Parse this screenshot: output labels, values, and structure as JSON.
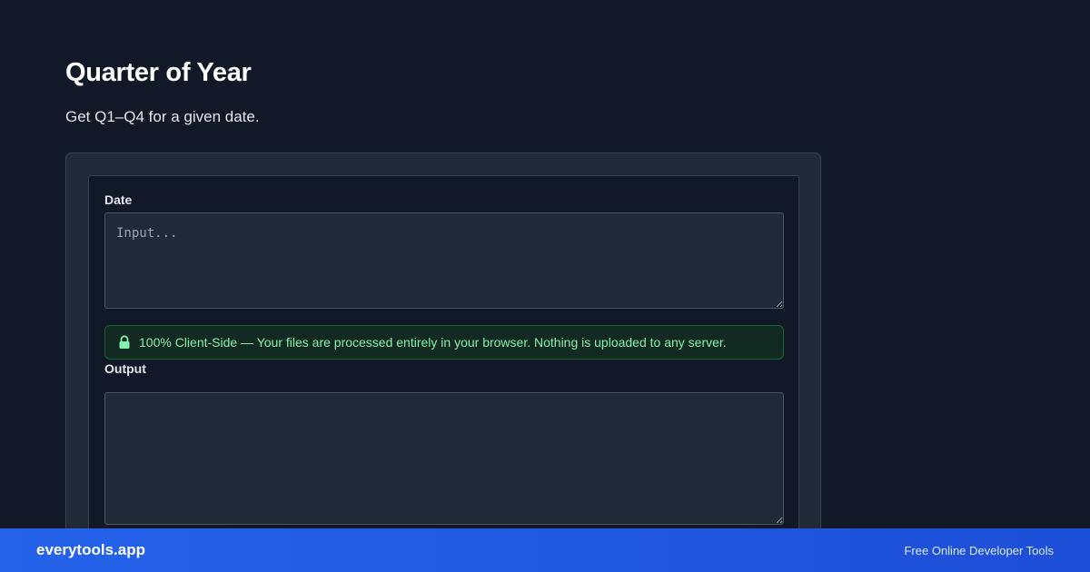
{
  "header": {
    "title": "Quarter of Year",
    "subtitle": "Get Q1–Q4 for a given date."
  },
  "form": {
    "date_label": "Date",
    "date_placeholder": "Input...",
    "date_value": "",
    "notice_icon": "lock-icon",
    "notice_text": "100% Client-Side — Your files are processed entirely in your browser. Nothing is uploaded to any server.",
    "output_label": "Output",
    "output_value": ""
  },
  "footer": {
    "brand": "everytools.app",
    "tagline": "Free Online Developer Tools"
  },
  "colors": {
    "background": "#111827",
    "card": "#1f2937",
    "accent": "#2563eb",
    "notice_text": "#86efac"
  }
}
